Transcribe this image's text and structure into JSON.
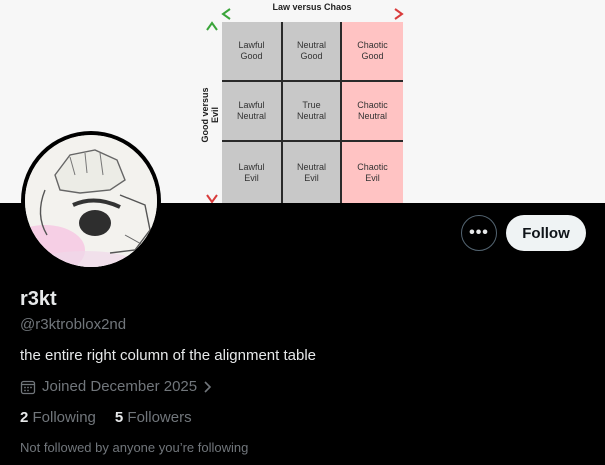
{
  "banner": {
    "chart_title": "Law versus Chaos",
    "y_axis_label": "Good versus Evil",
    "cells": [
      [
        "Lawful\nGood",
        "Neutral\nGood",
        "Chaotic\nGood"
      ],
      [
        "Lawful\nNeutral",
        "True\nNeutral",
        "Chaotic\nNeutral"
      ],
      [
        "Lawful\nEvil",
        "Neutral\nEvil",
        "Chaotic\nEvil"
      ]
    ],
    "colors": {
      "neutral_cell": "#c8c8c8",
      "highlight_cell": "#ffc3c3",
      "arrow_green": "#3aa53a",
      "arrow_red": "#d93b3b"
    }
  },
  "profile": {
    "display_name": "r3kt",
    "handle": "@r3ktroblox2nd",
    "bio": "the entire right column of the alignment table",
    "joined": "Joined December 2025",
    "following_count": "2",
    "following_label": "Following",
    "followers_count": "5",
    "followers_label": "Followers",
    "followed_by_note": "Not followed by anyone you’re following"
  },
  "actions": {
    "more_icon": "more-horizontal-icon",
    "more_glyph": "•••",
    "follow_label": "Follow"
  },
  "icons": {
    "calendar": "calendar-icon",
    "chevron": "chevron-right-icon"
  }
}
